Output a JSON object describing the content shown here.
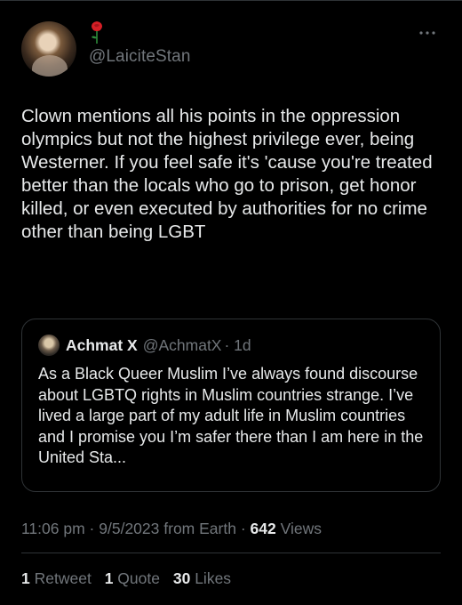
{
  "author": {
    "handle": "@LaiciteStan",
    "emoji_icon": "rose-icon"
  },
  "tweet": {
    "text": "Clown mentions all his points in the oppression olympics but not the highest privilege ever, being Westerner. If you feel safe it's 'cause you're treated better than the locals who go to prison, get honor killed, or even executed by authorities for no crime other than being LGBT"
  },
  "quoted": {
    "name": "Achmat X",
    "handle": "@AchmatX",
    "time": "· 1d",
    "text": "As a Black Queer Muslim I’ve always found discourse about LGBTQ rights in Muslim countries strange. I’ve lived a large part of my adult life in Muslim countries and I promise you I’m safer there than I am here in the United Sta..."
  },
  "meta": {
    "time": "11:06 pm",
    "sep1": "·",
    "date": "9/5/2023",
    "source": "from Earth",
    "sep2": "·",
    "views_count": "642",
    "views_label": "Views"
  },
  "stats": {
    "retweets_count": "1",
    "retweets_label": "Retweet",
    "quotes_count": "1",
    "quotes_label": "Quote",
    "likes_count": "30",
    "likes_label": "Likes"
  },
  "colors": {
    "background": "#000000",
    "text": "#e7e9ea",
    "secondary": "#71767b",
    "border": "#2f3336",
    "rose": "#d61f26"
  }
}
